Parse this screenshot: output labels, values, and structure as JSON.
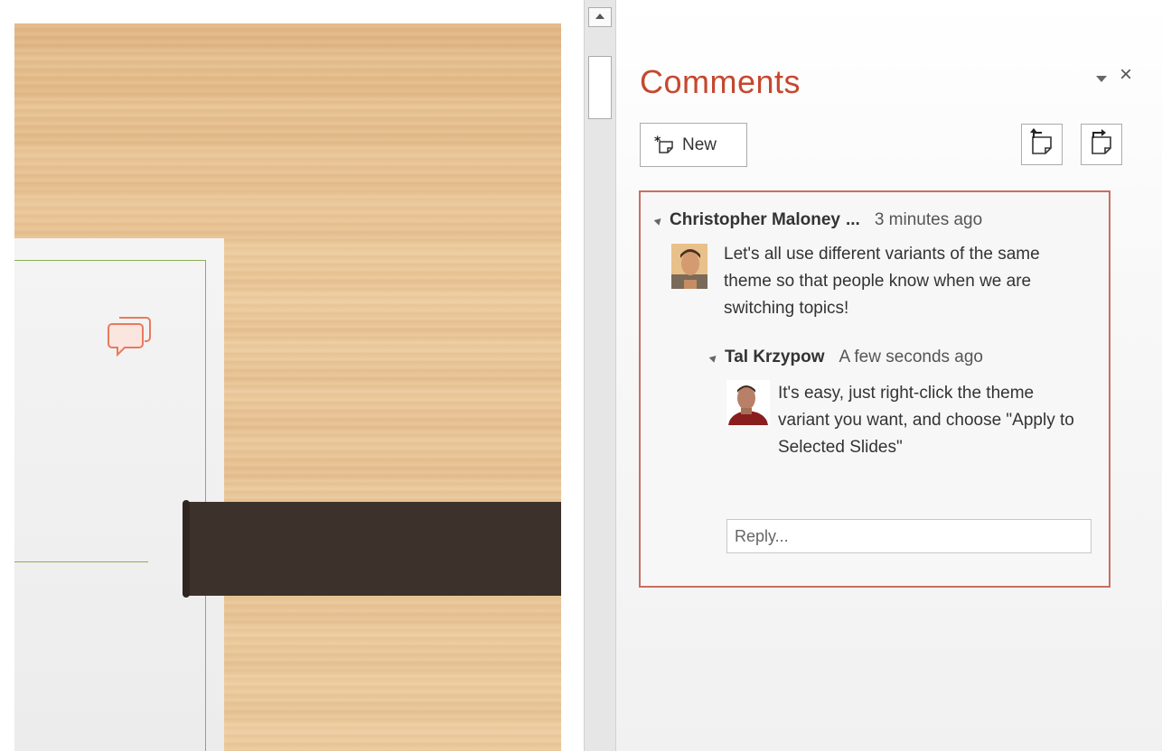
{
  "slide": {
    "comment_marker_icon": "comment-bubbles-icon",
    "colors": {
      "wood": "#e8c394",
      "card": "#f0f0f0",
      "card_border": "#8cae58",
      "dark_band": "#3d322b",
      "comment_marker": "#e87a5e"
    }
  },
  "scrollbar": {
    "up_icon": "scroll-up-arrow-icon"
  },
  "pane": {
    "title": "Comments",
    "options_icon": "dropdown-arrow-icon",
    "close_label": "×",
    "new_button": {
      "label": "New",
      "icon": "new-comment-icon"
    },
    "previous_button": {
      "icon": "previous-comment-icon"
    },
    "next_button": {
      "icon": "next-comment-icon"
    },
    "accent_color": "#c5482f",
    "thread_border_color": "#c86f63"
  },
  "thread": {
    "comment": {
      "author": "Christopher Maloney",
      "ellipsis": "...",
      "time": "3 minutes ago",
      "text": "Let's all use different variants of the same theme so that people know when we are switching topics!",
      "avatar_icon": "user-avatar"
    },
    "reply": {
      "author": "Tal Krzypow",
      "time": "A few seconds ago",
      "text": "It's easy, just right-click the theme variant you want, and choose \"Apply to Selected Slides\"",
      "avatar_icon": "user-avatar"
    },
    "reply_input": {
      "value": "",
      "placeholder": "Reply..."
    }
  }
}
